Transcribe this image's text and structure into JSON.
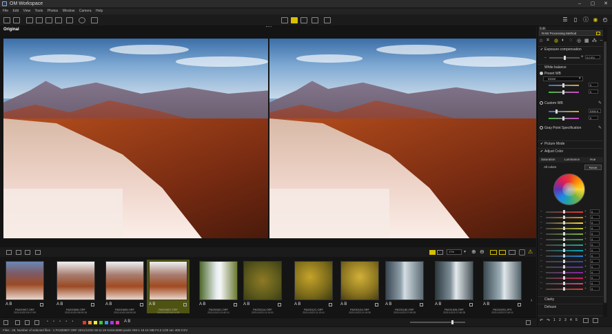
{
  "window": {
    "title": "OM Workspace",
    "min": "–",
    "max": "▢",
    "close": "✕"
  },
  "menu": [
    "File",
    "Edit",
    "View",
    "Tools",
    "Photos",
    "Window",
    "Camera",
    "Help"
  ],
  "viewer": {
    "label": "Original"
  },
  "zoom": "17%",
  "thumbnails": [
    {
      "name": "PA200907.ORF",
      "date": "2021/10/20 09:17:00",
      "ab": "A B",
      "selected": false
    },
    {
      "name": "PA200606.ORF",
      "date": "2021/10/20 06:09:16",
      "ab": "A B",
      "selected": false
    },
    {
      "name": "PA200605.ORF",
      "date": "2021/10/20 06:09:30",
      "ab": "A B",
      "selected": false
    },
    {
      "name": "PA200607.ORF",
      "date": "2021/10/20 06:11:28",
      "ab": "A B",
      "selected": true
    },
    {
      "name": "PA230001.ORF",
      "date": "2021/10/23 10:40:11",
      "ab": "A B",
      "selected": false
    },
    {
      "name": "PA230114.ORF",
      "date": "2021/10/23 11:10:01",
      "ab": "A B",
      "selected": false
    },
    {
      "name": "PA230121.ORF",
      "date": "2021/10/23 11:13:41",
      "ab": "A B",
      "selected": false
    },
    {
      "name": "PA230124.ORF",
      "date": "2021/10/23 11:19:30",
      "ab": "A B",
      "selected": false
    },
    {
      "name": "PA231182.ORF",
      "date": "2021/10/23 07:45:28",
      "ab": "A B",
      "selected": false
    },
    {
      "name": "PA231926.ORF",
      "date": "2021/10/23 07:46:28",
      "ab": "A B",
      "selected": false
    },
    {
      "name": "PA231933.JPG",
      "date": "2021/10/23 07:49:11",
      "ab": "A B",
      "selected": false
    }
  ],
  "status": "Files : 29, Number of selected files : 1  PA200907.ORF  2021/10/20 06:11:28  5184x3888 pixels  OM-1  19.1K MB  F4.0  1/30 sec  400  0 EV",
  "panel": {
    "edit_label": "Edit",
    "raw_method": "RAW Processing Method",
    "exposure": {
      "label": "Exposure compensation",
      "value": "0.0 EV"
    },
    "wb": {
      "label": "White balance",
      "preset_label": "Preset WB",
      "preset_value": "5300K",
      "preset_a": "0",
      "preset_g": "0",
      "custom_label": "Custom WB",
      "custom_value": "5300 K",
      "custom_g": "0",
      "gray_label": "Gray Point Specification"
    },
    "picture_mode": "Picture Mode",
    "adjust_color": "Adjust Color",
    "tabs": [
      "Saturation",
      "Luminance",
      "Hue"
    ],
    "all_colors": "All colors",
    "reset": "Reset",
    "color_rows": [
      "0",
      "0",
      "0",
      "0",
      "0",
      "0",
      "0",
      "0",
      "0",
      "0",
      "0",
      "0",
      "0",
      "0",
      "0"
    ],
    "clarity": "Clarity",
    "dehaze": "Dehaze"
  },
  "colors": {
    "accent": "#a8c400",
    "selection": "#4f5312",
    "warning": "#e6c200"
  }
}
